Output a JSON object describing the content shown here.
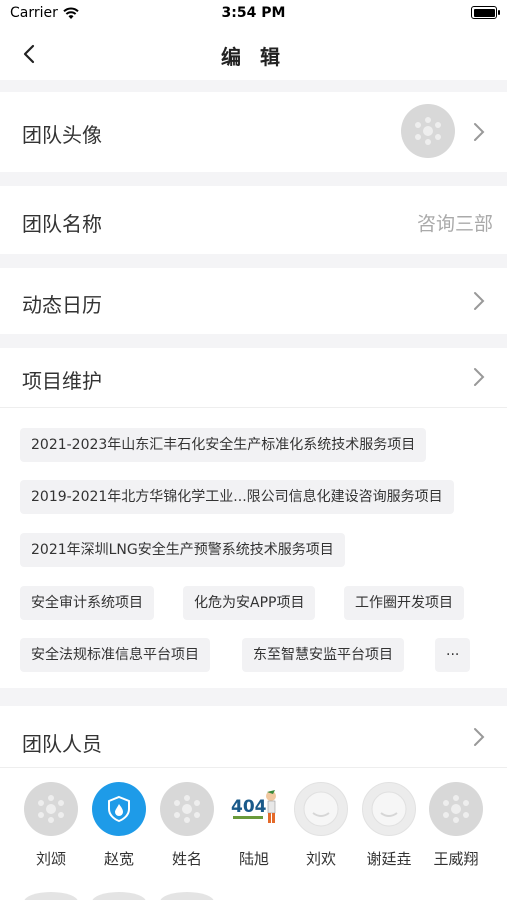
{
  "status": {
    "carrier": "Carrier",
    "time": "3:54 PM"
  },
  "nav": {
    "title": "编 辑"
  },
  "rows": {
    "avatar_label": "团队头像",
    "name_label": "团队名称",
    "name_value": "咨询三部",
    "calendar_label": "动态日历",
    "projects_label": "项目维护",
    "members_label": "团队人员"
  },
  "projects": [
    "2021-2023年山东汇丰石化安全生产标准化系统技术服务项目",
    "2019-2021年北方华锦化学工业...限公司信息化建设咨询服务项目",
    "2021年深圳LNG安全生产预警系统技术服务项目",
    "安全审计系统项目",
    "化危为安APP项目",
    "工作圈开发项目",
    "安全法规标准信息平台项目",
    "东至智慧安监平台项目",
    "···"
  ],
  "members": [
    {
      "name": "刘颂",
      "avatar": "grey"
    },
    {
      "name": "赵宽",
      "avatar": "blue"
    },
    {
      "name": "姓名",
      "avatar": "grey"
    },
    {
      "name": "陆旭",
      "avatar": "img404"
    },
    {
      "name": "刘欢",
      "avatar": "light"
    },
    {
      "name": "谢廷垚",
      "avatar": "light"
    },
    {
      "name": "王威翔",
      "avatar": "grey"
    }
  ],
  "colors": {
    "accent": "#1e9be8",
    "placeholder": "#d8d8d8",
    "background": "#f4f4f6"
  }
}
